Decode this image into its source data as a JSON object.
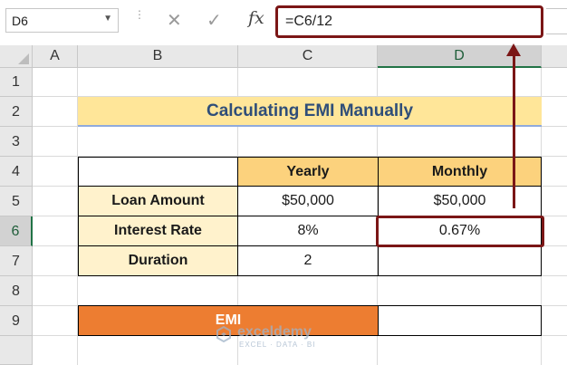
{
  "formula_bar": {
    "name_box": "D6",
    "formula": "=C6/12",
    "fx_label": "fx",
    "cancel_icon": "close-icon",
    "enter_icon": "check-icon"
  },
  "columns": [
    "A",
    "B",
    "C",
    "D"
  ],
  "rows": [
    "1",
    "2",
    "3",
    "4",
    "5",
    "6",
    "7",
    "8",
    "9"
  ],
  "selected_cell": "D6",
  "title": "Calculating EMI Manually",
  "table": {
    "headers": [
      "Yearly",
      "Monthly"
    ],
    "rows": [
      {
        "label": "Loan Amount",
        "yearly": "$50,000",
        "monthly": "$50,000"
      },
      {
        "label": "Interest Rate",
        "yearly": "8%",
        "monthly": "0.67%"
      },
      {
        "label": "Duration",
        "yearly": "2",
        "monthly": ""
      }
    ]
  },
  "emi": {
    "label": "EMI",
    "value": ""
  },
  "watermark": {
    "brand": "exceldemy",
    "tagline": "EXCEL · DATA · BI"
  },
  "colors": {
    "title_fill": "#ffe699",
    "title_text": "#2f4e79",
    "header_fill": "#fcd27d",
    "label_fill": "#fff2cc",
    "emi_fill": "#ed7d31",
    "highlight": "#7b1616",
    "excel_green": "#217346"
  }
}
